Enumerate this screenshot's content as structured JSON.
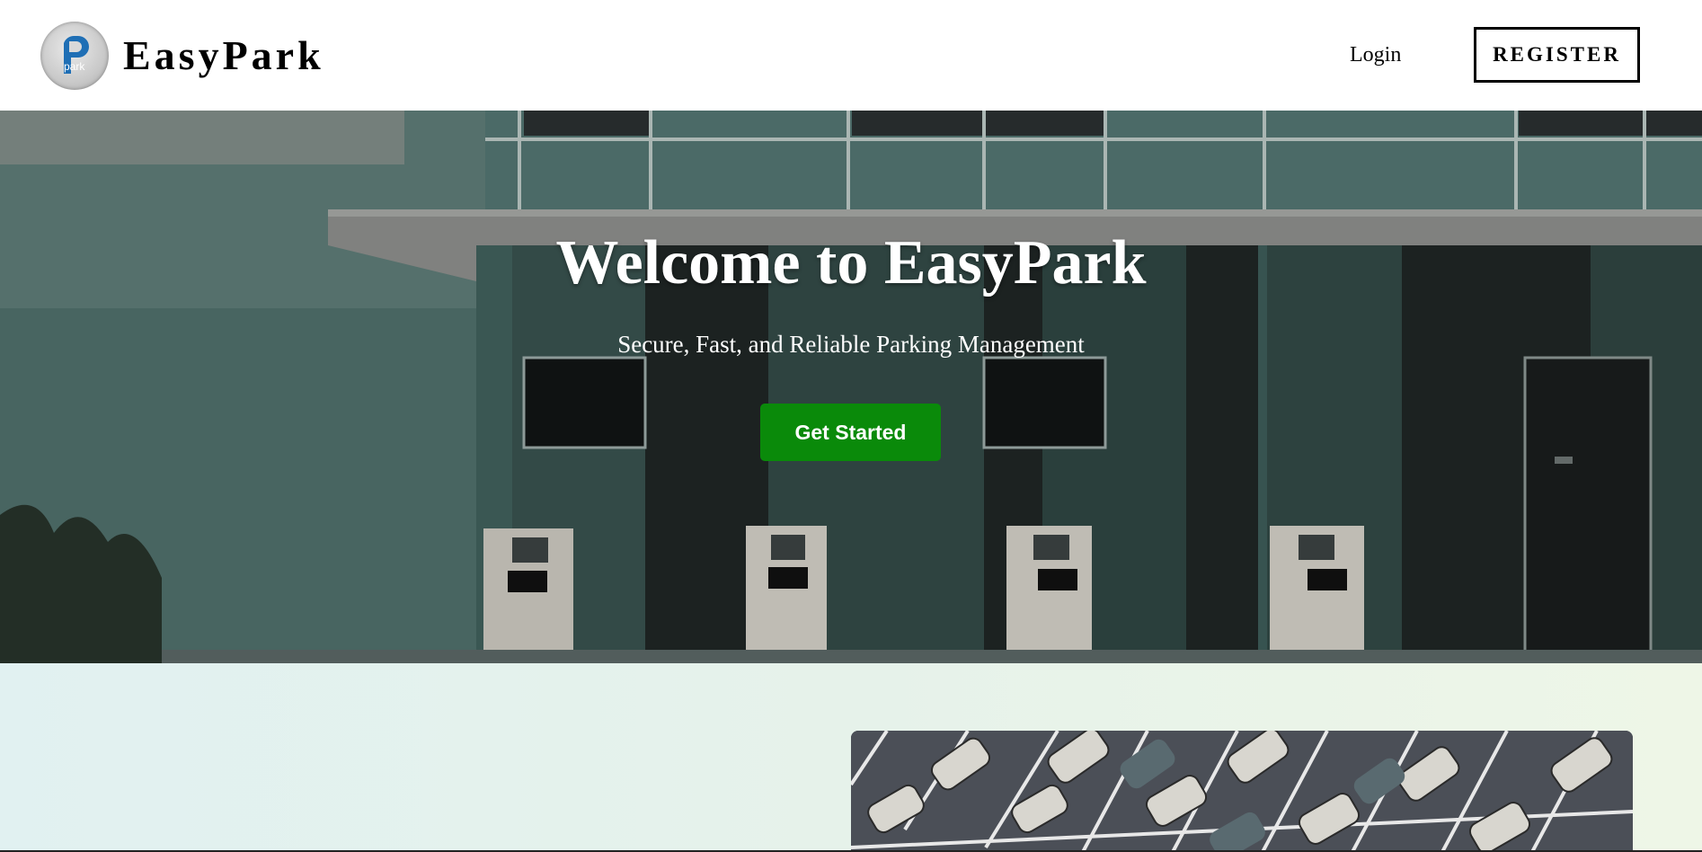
{
  "header": {
    "brand": "EasyPark",
    "logo_text": "park",
    "logo_icon": "p-park-logo-icon",
    "login_label": "Login",
    "register_label": "REGISTER"
  },
  "hero": {
    "title": "Welcome to EasyPark",
    "subtitle": "Secure, Fast, and Reliable Parking Management",
    "cta_label": "Get Started",
    "cta_color": "#0a8a0a",
    "background_image": "building-with-ev-chargers-image"
  },
  "features": {
    "image": "parking-lot-aerial-image"
  }
}
